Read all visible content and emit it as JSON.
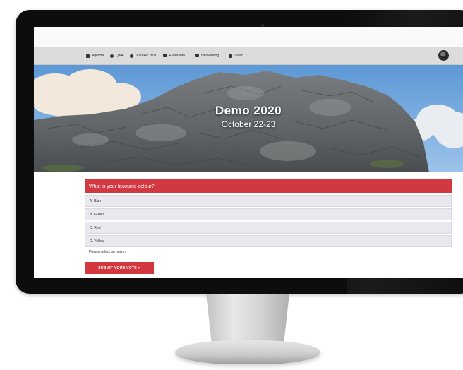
{
  "nav": {
    "items": [
      {
        "label": "Agenda",
        "icon": "calendar-icon",
        "dropdown": false
      },
      {
        "label": "Q&A",
        "icon": "chat-icon",
        "dropdown": false
      },
      {
        "label": "Speaker Bios",
        "icon": "people-icon",
        "dropdown": false
      },
      {
        "label": "Event Info",
        "icon": "folder-icon",
        "dropdown": true
      },
      {
        "label": "Networking",
        "icon": "folder-icon",
        "dropdown": true
      },
      {
        "label": "Video",
        "icon": "video-icon",
        "dropdown": false
      }
    ],
    "avatar_icon": "user-avatar-icon"
  },
  "hero": {
    "title": "Demo 2020",
    "subtitle": "October 22-23"
  },
  "poll": {
    "question": "What is your favourite colour?",
    "options": [
      "A. Blue",
      "B. Green",
      "C. Red",
      "D. Yellow"
    ],
    "helper": "Please select an option",
    "submit_label": "SUBMIT YOUR VOTE >"
  },
  "colors": {
    "accent": "#d3373f",
    "option_bg": "#e9e8ee",
    "navbar_bg": "#dcdcdc",
    "bezel": "#0d0d0d"
  }
}
